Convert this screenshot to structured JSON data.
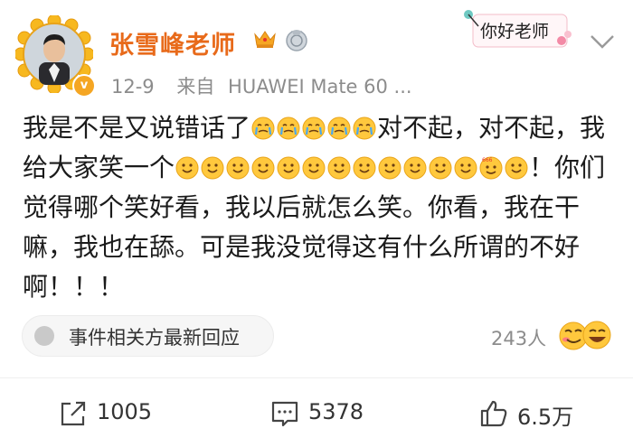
{
  "header": {
    "username": "张雪峰老师",
    "date": "12-9",
    "source_prefix": "来自",
    "device": "HUAWEI Mate 60 ...",
    "sticker_text": "你好老师"
  },
  "post": {
    "segments": [
      {
        "t": "text",
        "v": "我是不是又说错话了"
      },
      {
        "t": "emoji",
        "n": "crying-emoji"
      },
      {
        "t": "emoji",
        "n": "crying-emoji"
      },
      {
        "t": "emoji",
        "n": "crying-emoji"
      },
      {
        "t": "emoji",
        "n": "crying-emoji"
      },
      {
        "t": "emoji",
        "n": "crying-emoji"
      },
      {
        "t": "text",
        "v": "对不起，对不起，我给大家笑一个"
      },
      {
        "t": "emoji",
        "n": "smile-emoji"
      },
      {
        "t": "emoji",
        "n": "blush-emoji"
      },
      {
        "t": "emoji",
        "n": "laugh-cry-emoji"
      },
      {
        "t": "emoji",
        "n": "grin-emoji"
      },
      {
        "t": "emoji",
        "n": "tongue-emoji"
      },
      {
        "t": "emoji",
        "n": "wink-tongue-emoji"
      },
      {
        "t": "emoji",
        "n": "surprised-emoji"
      },
      {
        "t": "emoji",
        "n": "kiss-emoji"
      },
      {
        "t": "emoji",
        "n": "smirk-emoji"
      },
      {
        "t": "emoji",
        "n": "big-grin-emoji"
      },
      {
        "t": "emoji",
        "n": "happy-emoji"
      },
      {
        "t": "emoji",
        "n": "thinking-emoji"
      },
      {
        "t": "emoji",
        "n": "666-emoji"
      },
      {
        "t": "emoji",
        "n": "cheeky-emoji"
      },
      {
        "t": "text",
        "v": "！你们觉得哪个笑好看，我以后就怎么笑。你看，我在干嘛，我也在舔。可是我没觉得这有什么所谓的不好啊！！！"
      }
    ]
  },
  "event": {
    "label": "事件相关方最新回应"
  },
  "reactions": {
    "count": "243人"
  },
  "actions": {
    "repost": "1005",
    "comment": "5378",
    "like": "6.5万"
  },
  "colors": {
    "username": "#e86a1a",
    "emoji": "#ffc83d"
  }
}
